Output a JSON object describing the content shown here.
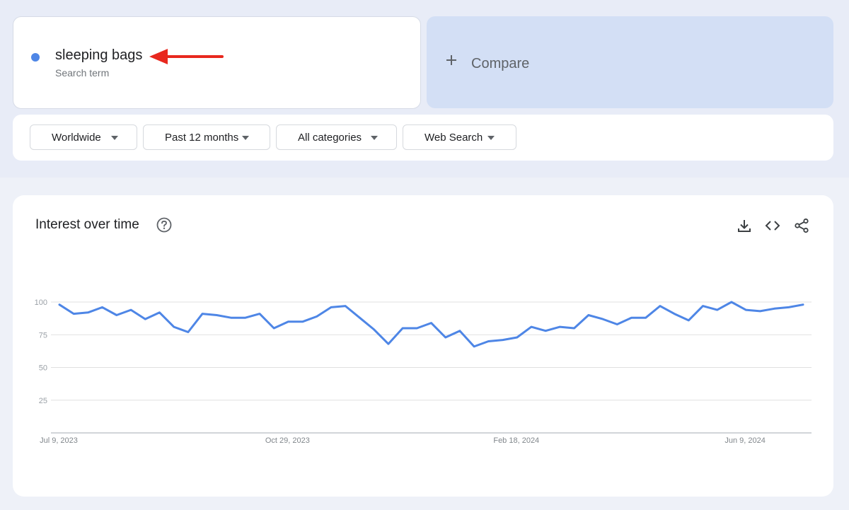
{
  "term": {
    "name": "sleeping bags",
    "subtitle": "Search term",
    "dot_color": "#4e86e6",
    "annotation_arrow_color": "#e8281e"
  },
  "compare": {
    "label": "Compare",
    "icon": "plus-icon"
  },
  "filters": [
    {
      "label": "Worldwide",
      "icon": "caret-down-icon"
    },
    {
      "label": "Past 12 months",
      "icon": "caret-down-icon"
    },
    {
      "label": "All categories",
      "icon": "caret-down-icon"
    },
    {
      "label": "Web Search",
      "icon": "caret-down-icon"
    }
  ],
  "panel": {
    "title": "Interest over time",
    "icons": [
      "help-icon",
      "download-icon",
      "embed-code-icon",
      "share-icon"
    ]
  },
  "chart_data": {
    "type": "line",
    "title": "Interest over time",
    "ylim": [
      0,
      100
    ],
    "y_ticks": [
      25,
      50,
      75,
      100
    ],
    "x_tick_labels": [
      "Jul 9, 2023",
      "Oct 29, 2023",
      "Feb 18, 2024",
      "Jun 9, 2024"
    ],
    "x_tick_indices": [
      0,
      16,
      32,
      48
    ],
    "grid": true,
    "series": [
      {
        "color": "#4e86e6",
        "values": [
          98,
          91,
          92,
          96,
          90,
          94,
          87,
          92,
          81,
          77,
          91,
          90,
          88,
          88,
          91,
          80,
          85,
          85,
          89,
          96,
          97,
          88,
          79,
          68,
          80,
          80,
          84,
          73,
          78,
          66,
          70,
          71,
          73,
          81,
          78,
          81,
          80,
          90,
          87,
          83,
          88,
          88,
          97,
          91,
          86,
          97,
          94,
          100,
          94,
          93,
          95,
          96,
          98
        ]
      }
    ]
  }
}
